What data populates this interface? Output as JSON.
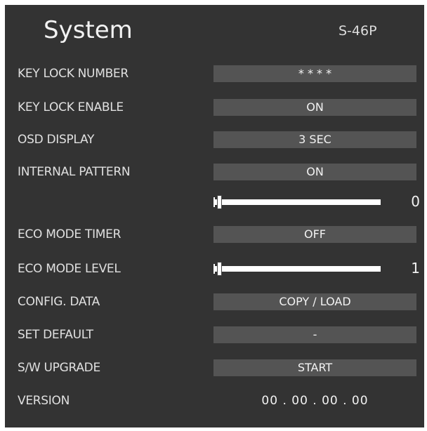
{
  "header": {
    "title": "System",
    "model": "S-46P"
  },
  "items": [
    {
      "label": "KEY LOCK NUMBER",
      "value": "* * * *"
    },
    {
      "label": "KEY LOCK ENABLE",
      "value": "ON"
    },
    {
      "label": "OSD DISPLAY",
      "value": "3 SEC"
    },
    {
      "label": "INTERNAL PATTERN",
      "value": "ON"
    },
    {
      "label": "",
      "slider_value": "0",
      "slider_level": 0
    },
    {
      "label": "ECO MODE TIMER",
      "value": "OFF"
    },
    {
      "label": "ECO MODE LEVEL",
      "slider_value": "1",
      "slider_level": 0
    },
    {
      "label": "CONFIG. DATA",
      "value": "COPY / LOAD"
    },
    {
      "label": "SET DEFAULT",
      "value": "-"
    },
    {
      "label": "S/W UPGRADE",
      "value": "START"
    },
    {
      "label": "VERSION",
      "value": "00 . 00 . 00 . 00"
    }
  ],
  "colors": {
    "panel": "#333333",
    "field": "#545454",
    "text": "#e0e0e0",
    "slider": "#ffffff"
  }
}
